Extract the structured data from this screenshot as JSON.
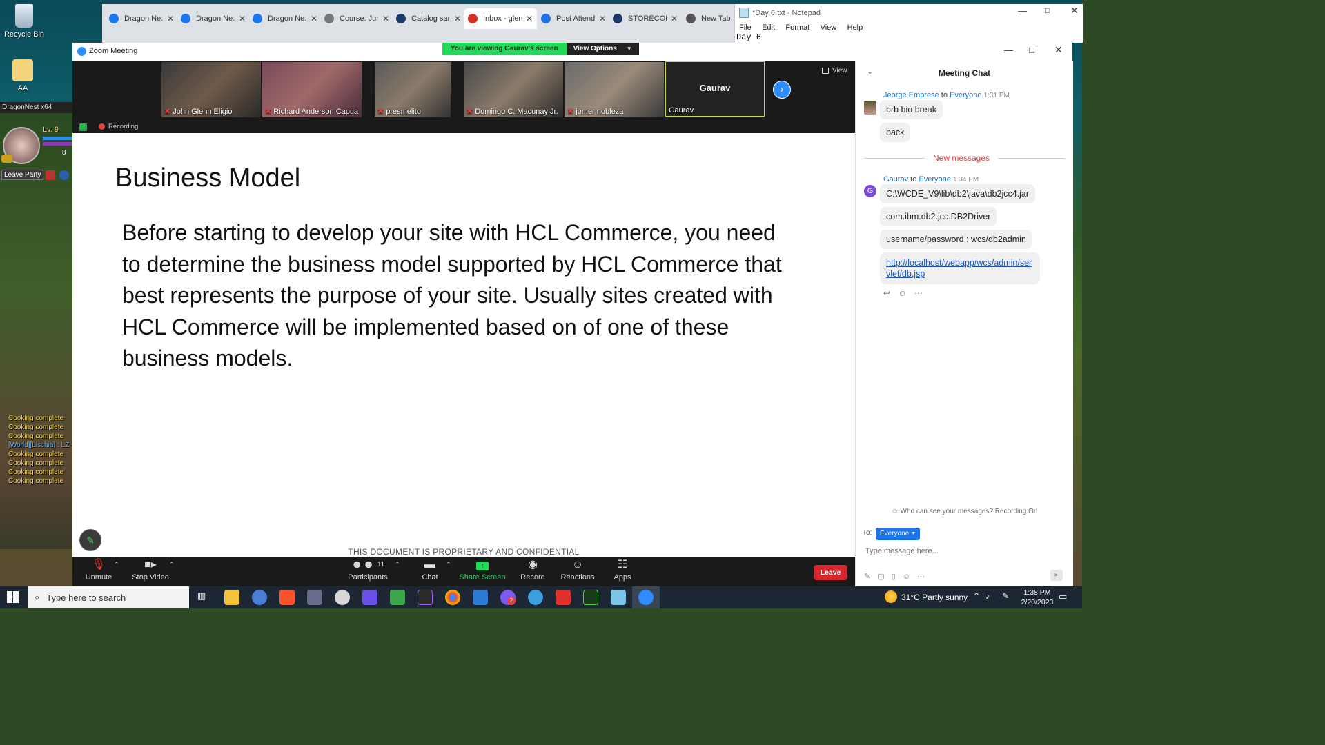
{
  "desktop": {
    "icons": [
      {
        "label": "Recycle Bin"
      },
      {
        "label": "AA"
      }
    ],
    "game": {
      "window_title": "DragonNest x64",
      "level": "Lv. 9",
      "small_value": "8",
      "leave_party": "Leave Party",
      "chat_lines": [
        "Cooking complete",
        "Cooking complete",
        "Cooking complete",
        "[World][Lischia] : LZ",
        "Cooking complete",
        "Cooking complete",
        "Cooking complete",
        "Cooking complete"
      ]
    }
  },
  "browser": {
    "tabs": [
      {
        "title": "Dragon Ne:",
        "icon": "facebook-icon",
        "color": "#1877f2"
      },
      {
        "title": "Dragon Ne:",
        "icon": "facebook-icon",
        "color": "#1877f2"
      },
      {
        "title": "Dragon Ne:",
        "icon": "facebook-icon",
        "color": "#1877f2"
      },
      {
        "title": "Course: Jum",
        "icon": "course-icon",
        "color": "#777777"
      },
      {
        "title": "Catalog san",
        "icon": "catalog-icon",
        "color": "#1b3a6b"
      },
      {
        "title": "Inbox - glen",
        "icon": "gmail-icon",
        "color": "#d93025"
      },
      {
        "title": "Post Attend",
        "icon": "zoho-icon",
        "color": "#1a73e8"
      },
      {
        "title": "STORECONF",
        "icon": "storeconf-icon",
        "color": "#1b3a6b"
      },
      {
        "title": "New Tab",
        "icon": "chrome-icon",
        "color": "#555555"
      }
    ]
  },
  "notepad": {
    "title": "*Day 6.txt - Notepad",
    "menu": [
      "File",
      "Edit",
      "Format",
      "View",
      "Help"
    ],
    "content": "Day 6"
  },
  "zoom": {
    "title": "Zoom Meeting",
    "share_banner": "You are viewing Gaurav's screen",
    "view_options": "View Options",
    "view_label": "View",
    "recording": "Recording",
    "participants": [
      {
        "name": "John Glenn Eligio",
        "muted": true
      },
      {
        "name": "Richard Anderson Capua",
        "muted": true
      },
      {
        "name": "presmelito",
        "muted": true
      },
      {
        "name": "Domingo C. Macunay Jr.",
        "muted": true
      },
      {
        "name": "jomer nobleza",
        "muted": true
      },
      {
        "name": "Gaurav",
        "display": "Gaurav",
        "muted": false
      }
    ],
    "slide": {
      "heading": "Business Model",
      "body": "Before starting to develop your site with HCL Commerce, you need to determine the business model supported by HCL Commerce that best represents the purpose of your site. Usually sites created with HCL Commerce will be implemented based on of one of these business models.",
      "footer": "THIS DOCUMENT IS PROPRIETARY AND CONFIDENTIAL"
    },
    "toolbar": {
      "unmute": "Unmute",
      "stop_video": "Stop Video",
      "participants": "Participants",
      "participant_count": "11",
      "chat": "Chat",
      "share_screen": "Share Screen",
      "record": "Record",
      "reactions": "Reactions",
      "apps": "Apps",
      "leave": "Leave"
    },
    "chat": {
      "title": "Meeting Chat",
      "group1": {
        "sender": "Jeorge Emprese",
        "to_word": "to",
        "recipient": "Everyone",
        "time": "1:31 PM",
        "messages": [
          "brb bio break",
          "back"
        ]
      },
      "new_messages": "New messages",
      "group2": {
        "avatar": "G",
        "sender": "Gaurav",
        "to_word": "to",
        "recipient": "Everyone",
        "time": "1:34 PM",
        "messages": [
          "C:\\WCDE_V9\\lib\\db2\\java\\db2jcc4.jar",
          "com.ibm.db2.jcc.DB2Driver",
          "username/password : wcs/db2admin"
        ],
        "link": "http://localhost/webapp/wcs/admin/servlet/db.jsp"
      },
      "privacy": "Who can see your messages? Recording On",
      "to_label": "To:",
      "to_value": "Everyone",
      "input_placeholder": "Type message here..."
    }
  },
  "taskbar": {
    "search_placeholder": "Type here to search",
    "weather": "31°C  Partly sunny",
    "time": "1:38 PM",
    "date": "2/20/2023",
    "badge": "2"
  }
}
